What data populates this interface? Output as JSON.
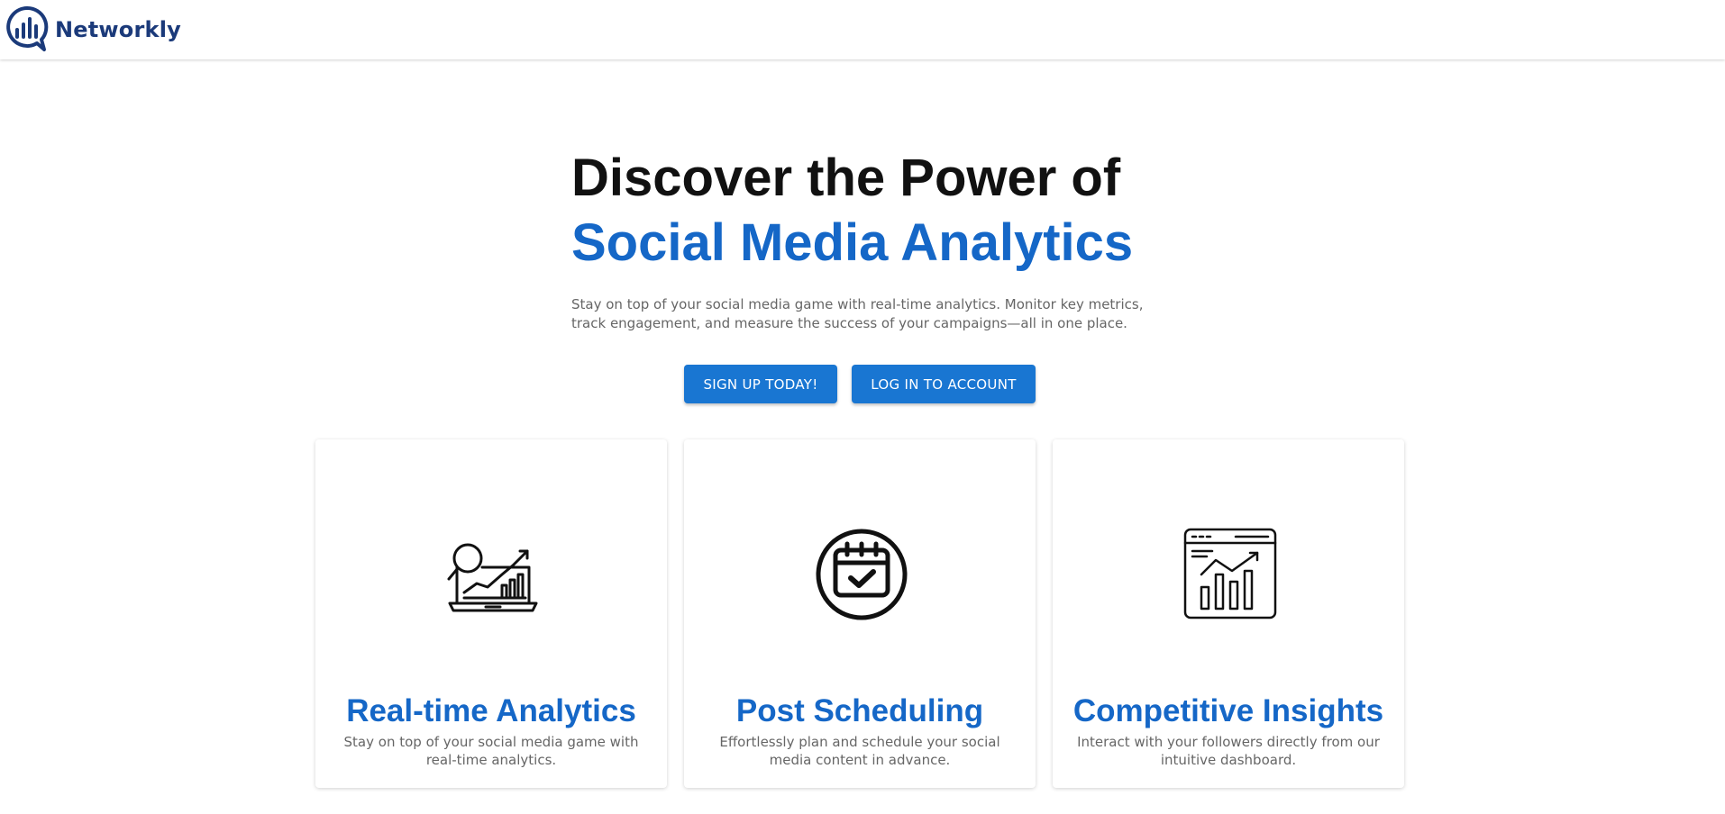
{
  "brand": {
    "name": "Networkly",
    "logo_icon": "chat-bubble-bar-chart-icon",
    "color": "#1b3a7a"
  },
  "hero": {
    "title_line1": "Discover the Power of",
    "title_line2": "Social Media Analytics",
    "description": "Stay on top of your social media game with real-time analytics. Monitor key metrics, track engagement, and measure the success of your campaigns—all in one place.",
    "accent_color": "#1567c7"
  },
  "actions": {
    "signup_label": "SIGN UP TODAY!",
    "login_label": "LOG IN TO ACCOUNT",
    "button_color": "#1976d2"
  },
  "features": [
    {
      "icon": "laptop-analytics-icon",
      "title": "Real-time Analytics",
      "description": "Stay on top of your social media game with real-time analytics."
    },
    {
      "icon": "calendar-check-icon",
      "title": "Post Scheduling",
      "description": "Effortlessly plan and schedule your social media content in advance."
    },
    {
      "icon": "browser-chart-icon",
      "title": "Competitive Insights",
      "description": "Interact with your followers directly from our intuitive dashboard."
    }
  ]
}
